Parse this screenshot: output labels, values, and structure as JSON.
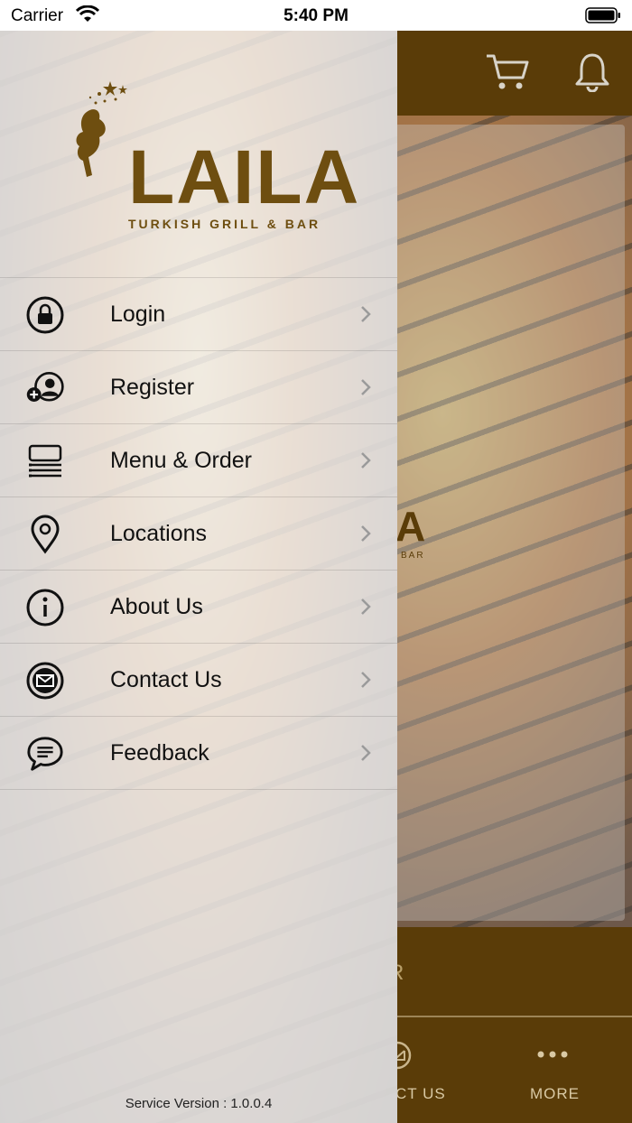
{
  "status_bar": {
    "carrier": "Carrier",
    "time": "5:40 PM"
  },
  "header": {
    "icons": [
      "cart-icon",
      "bell-icon"
    ]
  },
  "drawer": {
    "logo": {
      "name": "LAILA",
      "tagline": "TURKISH GRILL & BAR"
    },
    "menu": [
      {
        "label": "Login",
        "icon": "lock-icon"
      },
      {
        "label": "Register",
        "icon": "add-user-icon"
      },
      {
        "label": "Menu & Order",
        "icon": "menu-list-icon"
      },
      {
        "label": "Locations",
        "icon": "location-pin-icon"
      },
      {
        "label": "About Us",
        "icon": "info-icon"
      },
      {
        "label": "Contact Us",
        "icon": "mail-icon"
      },
      {
        "label": "Feedback",
        "icon": "chat-icon"
      }
    ],
    "version": "Service Version : 1.0.0.4"
  },
  "background": {
    "logo_fragment": "A",
    "logo_sub_fragment": "BAR",
    "band_fragment": "R",
    "tabs": [
      {
        "label": "CT US",
        "icon": "mail-icon"
      },
      {
        "label": "MORE",
        "icon": "more-icon"
      }
    ]
  },
  "colors": {
    "brand_brown": "#5a3c08",
    "logo_gold": "#6e4e10"
  }
}
